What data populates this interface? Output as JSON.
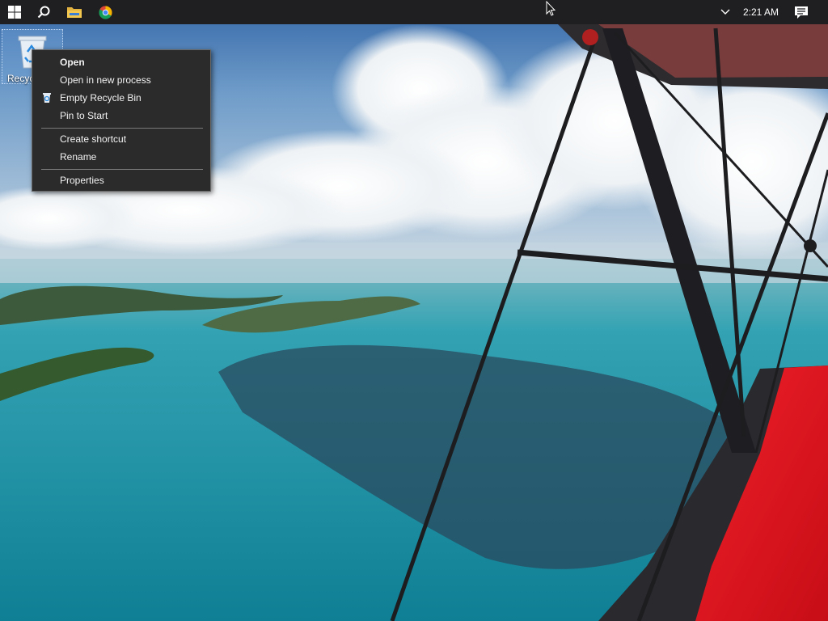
{
  "taskbar": {
    "start": "windows-start-icon",
    "search": "search-icon",
    "explorer": "file-explorer-icon",
    "chrome": "chrome-icon",
    "tray_chevron": "chevron-up-icon",
    "clock": "2:21 AM",
    "notifications": "action-center-icon"
  },
  "desktop": {
    "recycle_bin_label": "Recycle Bin",
    "recycle_bin_label_visible": "Recyc"
  },
  "context_menu": {
    "items": [
      {
        "label": "Open",
        "bold": true
      },
      {
        "label": "Open in new process"
      },
      {
        "label": "Empty Recycle Bin",
        "icon": "recycle-bin-icon"
      },
      {
        "label": "Pin to Start"
      },
      {
        "label": "Create shortcut"
      },
      {
        "label": "Rename"
      },
      {
        "label": "Properties"
      }
    ]
  },
  "colors": {
    "taskbar": "#1f1f22",
    "menu_bg": "#2b2b2b",
    "wing_red": "#e2141c"
  }
}
